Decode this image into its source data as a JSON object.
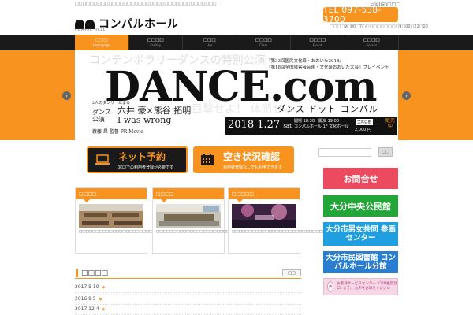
{
  "header": {
    "tagline": "□□□□□□□□□□□□□□□□□□□□□□□□□□□□□□□□□□□□□□",
    "english_link": "English□□□",
    "logo_text": "コンパルホール",
    "logo_sub": "COMPAL HALL",
    "tel": "TEL 097-538-3700",
    "hours": "□□□□9□00□7□□□□□□□□□□9□00□22□00"
  },
  "nav": {
    "items": [
      {
        "jp": "□□□",
        "en": "Homepage"
      },
      {
        "jp": "□□□□",
        "en": "Facility"
      },
      {
        "jp": "□□□",
        "en": "Use"
      },
      {
        "jp": "□□□□",
        "en": "Class"
      },
      {
        "jp": "□□□□",
        "en": "Event"
      },
      {
        "jp": "□□□□",
        "en": "Access"
      }
    ]
  },
  "hero": {
    "ghost_text": "コンテンポラリーダンスの特別公演",
    "fest_line1": "『第33回国民文化祭・おおいた2018』",
    "fest_line2": "『第18回全国障害者芸術・文化祭おおいた大会』プレイベント",
    "title": "DANCE.com",
    "title_kana": "ダンス ドット コンパル",
    "ghost_text2": "目撃せよ！ 体感せよ",
    "cast_intro": "2人のダンサーによる",
    "cast_kind": "ダンス 公演",
    "cast_names": "穴井 豪×熊谷 拓明",
    "cast_title": "I was wrong",
    "director": "蓑藤 昂 監督 PR Movie",
    "date_main": "2018 1.27",
    "date_day": "sat",
    "times_line1": "開場 18:30　開演 19:00",
    "times_line2": "コンパルホール 1F 文化ホール",
    "badge": "全席自由",
    "price": "2,000 円",
    "sale": "販売中",
    "prev_arrow": "‹",
    "next_arrow": "›"
  },
  "reservation": {
    "net_label": "ネット予約",
    "net_sub": "窓口での利用者登録が必要です",
    "avail_label": "空き状況確認",
    "avail_sub": "利用者登録なしでも利用できます"
  },
  "search": {
    "placeholder": "",
    "button": "□□"
  },
  "cards": [
    {
      "head": "□□□□",
      "text": "□□□□□□□□□□□□□□□□□□□□□□□□□□□□□□□□□□□□"
    },
    {
      "head": "□□□□",
      "text": "□□□□□□□□□□□□□□□□□□□□□□□□□□□□□□□□□□□□"
    },
    {
      "head": "□□□□□",
      "text": "□□□□□□□□□□□□□□□□□□□□□□□□□□□□□□□□□□□□"
    }
  ],
  "news": {
    "title": "□□□□",
    "more": "□□",
    "rows": [
      {
        "date": "2017 5 10"
      },
      {
        "date": "2016 9 5"
      },
      {
        "date": "2017 12 4"
      }
    ]
  },
  "side": {
    "contact": "お問合せ",
    "oita": "大分中央公民館",
    "gender": "大分市男女共同 参画センター",
    "library": "大分市民図書館 コンパルホール分館",
    "card_circle": "声",
    "card_text": "お客様サービスセンター (CRM推奨窓口) まで、 お声をお寄せください"
  },
  "colors": {
    "brand_orange": "#f7931e",
    "nav_dark": "#1a1a1a",
    "contact_red": "#ec4b5f",
    "oita_green": "#22a637",
    "gender_blue": "#1f9fe0",
    "library_blue": "#2b7dd0"
  }
}
